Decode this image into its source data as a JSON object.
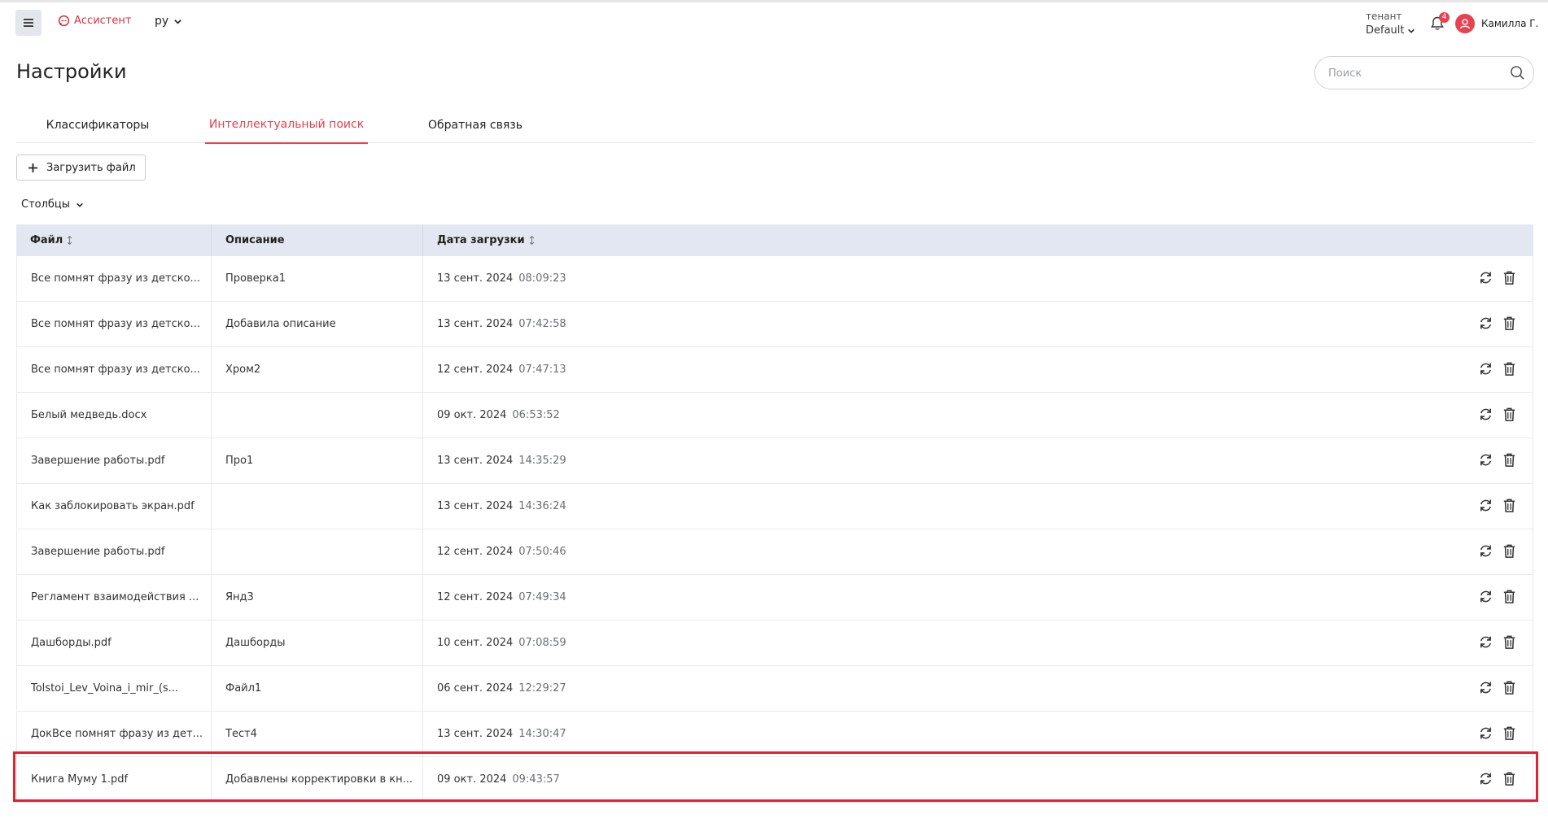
{
  "header": {
    "brand_label": "Ассистент",
    "language": "ру",
    "tenant_label": "тенант",
    "tenant_value": "Default",
    "notifications_count": "4",
    "user_name": "Камилла Г."
  },
  "page": {
    "title": "Настройки",
    "search_placeholder": "Поиск"
  },
  "tabs": [
    {
      "label": "Классификаторы",
      "active": false
    },
    {
      "label": "Интеллектуальный поиск",
      "active": true
    },
    {
      "label": "Обратная связь",
      "active": false
    }
  ],
  "toolbar": {
    "upload_label": "Загрузить файл",
    "columns_label": "Столбцы"
  },
  "table": {
    "headers": [
      "Файл",
      "Описание",
      "Дата загрузки"
    ],
    "rows": [
      {
        "file": "Все помнят фразу из детско...",
        "description": "Проверка1",
        "date": "13 сент. 2024",
        "time": "08:09:23"
      },
      {
        "file": "Все помнят фразу из детско...",
        "description": "Добавила описание",
        "date": "13 сент. 2024",
        "time": "07:42:58"
      },
      {
        "file": "Все помнят фразу из детско...",
        "description": "Хром2",
        "date": "12 сент. 2024",
        "time": "07:47:13"
      },
      {
        "file": "Белый медведь.docx",
        "description": "",
        "date": "09 окт. 2024",
        "time": "06:53:52"
      },
      {
        "file": "Завершение работы.pdf",
        "description": "Про1",
        "date": "13 сент. 2024",
        "time": "14:35:29"
      },
      {
        "file": "Как заблокировать экран.pdf",
        "description": "",
        "date": "13 сент. 2024",
        "time": "14:36:24"
      },
      {
        "file": "Завершение работы.pdf",
        "description": "",
        "date": "12 сент. 2024",
        "time": "07:50:46"
      },
      {
        "file": "Регламент взаимодействия ...",
        "description": "Янд3",
        "date": "12 сент. 2024",
        "time": "07:49:34"
      },
      {
        "file": "Дашборды.pdf",
        "description": "Дашборды",
        "date": "10 сент. 2024",
        "time": "07:08:59"
      },
      {
        "file": "Tolstoi_Lev_Voina_i_mir_(s...",
        "description": "Файл1",
        "date": "06 сент. 2024",
        "time": "12:29:27"
      },
      {
        "file": "ДокВсе помнят фразу из дет...",
        "description": "Тест4",
        "date": "13 сент. 2024",
        "time": "14:30:47"
      },
      {
        "file": "Книга Муму 1.pdf",
        "description": "Добавлены корректировки в кн...",
        "date": "09 окт. 2024",
        "time": "09:43:57"
      }
    ]
  },
  "colors": {
    "accent": "#e0424f",
    "header_bg": "#e2e7f1",
    "highlight": "#e0242f"
  }
}
